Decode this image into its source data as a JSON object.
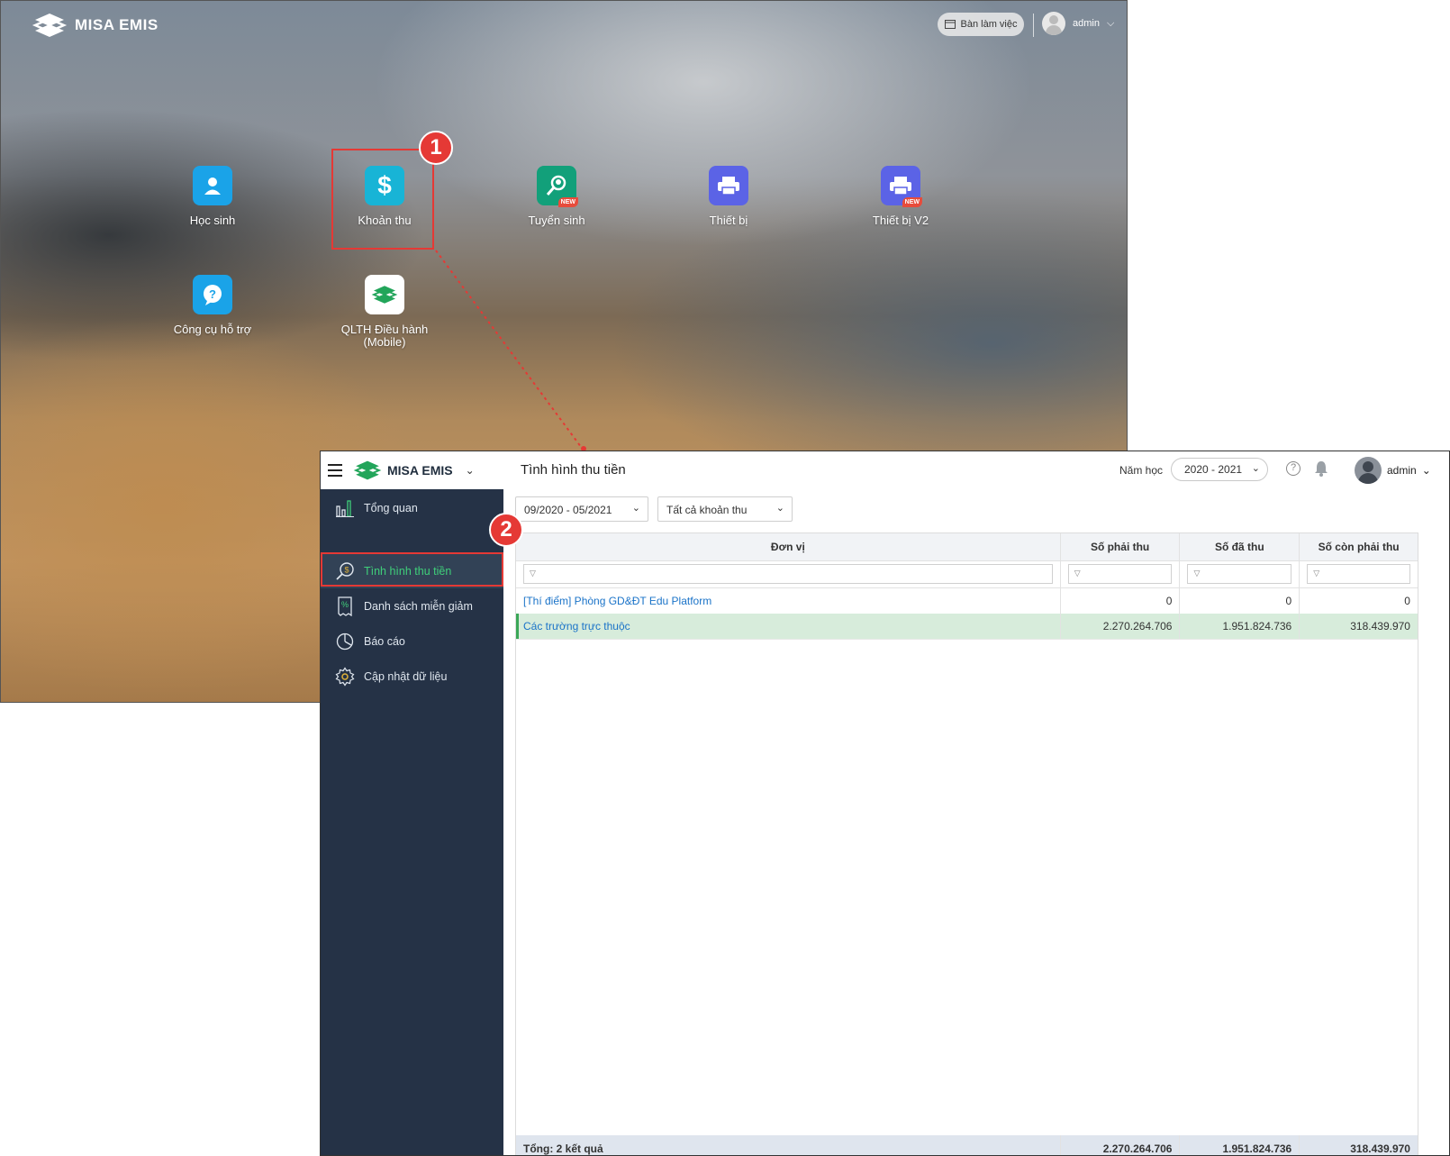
{
  "launcher": {
    "logo_text": "MISA EMIS",
    "workspace_button": "Bàn làm việc",
    "user": "admin",
    "apps": [
      {
        "label": "Học sinh",
        "icon": "student-icon",
        "color": "#1aa3e8",
        "new": false
      },
      {
        "label": "Khoản thu",
        "icon": "dollar-icon",
        "color": "#18b4d6",
        "new": false
      },
      {
        "label": "Tuyển sinh",
        "icon": "admission-search-icon",
        "color": "#12a07a",
        "new": true
      },
      {
        "label": "Thiết bị",
        "icon": "printer-icon",
        "color": "#5b63e6",
        "new": false
      },
      {
        "label": "Thiết bị V2",
        "icon": "printer-icon",
        "color": "#5b63e6",
        "new": true
      },
      {
        "label": "Công cụ hỗ trợ",
        "icon": "help-chat-icon",
        "color": "#1aa3e8",
        "new": false
      },
      {
        "label": "QLTH Điều hành (Mobile)",
        "label_line1": "QLTH Điều hành",
        "label_line2": "(Mobile)",
        "icon": "emis-logo-icon",
        "color": "#ffffff",
        "new": false
      }
    ],
    "new_badge": "NEW"
  },
  "steps": {
    "step1": "1",
    "step2": "2"
  },
  "app": {
    "logo_text": "MISA EMIS",
    "page_title": "Tình hình thu tiền",
    "year_label": "Năm học",
    "year_value": "2020 - 2021",
    "user": "admin",
    "sidebar": [
      {
        "label": "Tổng quan",
        "icon": "chart-bars-icon"
      },
      {
        "label": "Tình hình thu tiền",
        "icon": "money-search-icon",
        "active": true
      },
      {
        "label": "Danh sách miễn giảm",
        "icon": "discount-receipt-icon"
      },
      {
        "label": "Báo cáo",
        "icon": "pie-chart-icon"
      },
      {
        "label": "Cập nhật dữ liệu",
        "icon": "gear-icon"
      }
    ],
    "filters": {
      "period": "09/2020 - 05/2021",
      "fee_type": "Tất cả khoản thu"
    },
    "table": {
      "columns": [
        "Đơn vị",
        "Số phải thu",
        "Số đã thu",
        "Số còn phải thu"
      ],
      "rows": [
        {
          "unit": "[Thí điểm] Phòng GD&ĐT Edu Platform",
          "receivable": "0",
          "collected": "0",
          "remaining": "0"
        },
        {
          "unit": "Các trường trực thuộc",
          "receivable": "2.270.264.706",
          "collected": "1.951.824.736",
          "remaining": "318.439.970"
        }
      ],
      "footer": {
        "label": "Tổng: 2 kết quả",
        "receivable": "2.270.264.706",
        "collected": "1.951.824.736",
        "remaining": "318.439.970"
      }
    },
    "colors": {
      "sidebar": "#253246",
      "active_text": "#3fcf7a",
      "highlight": "#e53935",
      "selected_row": "#d7ecdb"
    }
  }
}
